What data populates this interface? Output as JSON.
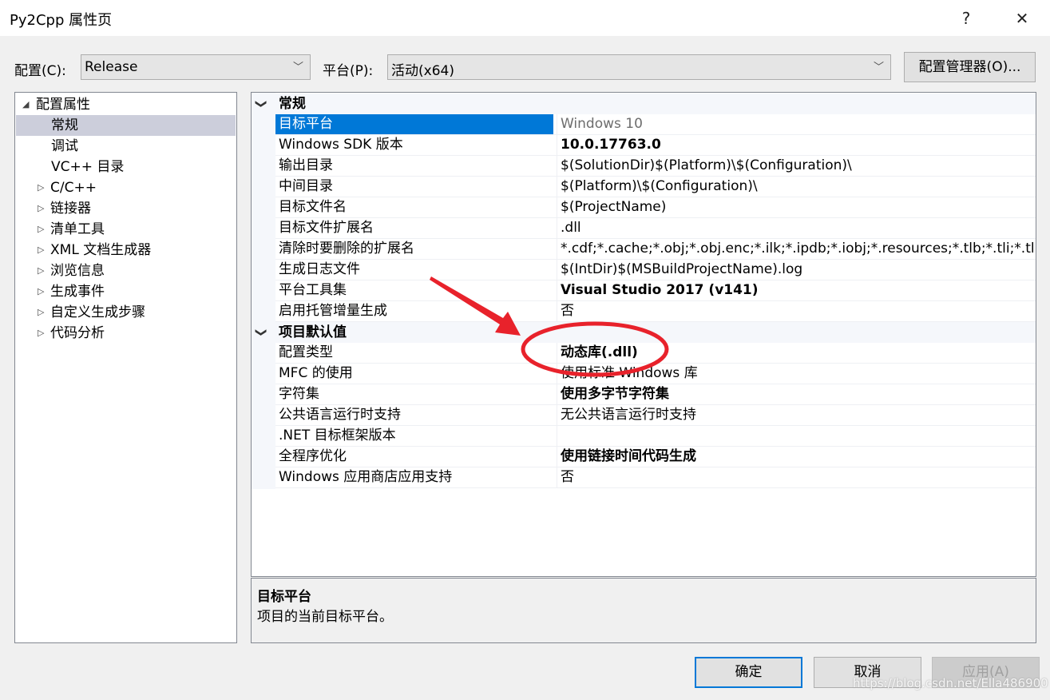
{
  "window": {
    "title": "Py2Cpp 属性页",
    "help": "?",
    "close": "✕"
  },
  "toolbar": {
    "config_label": "配置(C):",
    "config_value": "Release",
    "platform_label": "平台(P):",
    "platform_value": "活动(x64)",
    "config_manager": "配置管理器(O)..."
  },
  "tree": [
    {
      "label": "配置属性",
      "arrow": "◢",
      "expanded": true
    },
    {
      "label": "常规",
      "selected": true
    },
    {
      "label": "调试"
    },
    {
      "label": "VC++ 目录"
    },
    {
      "label": "C/C++",
      "arrow": "▷"
    },
    {
      "label": "链接器",
      "arrow": "▷"
    },
    {
      "label": "清单工具",
      "arrow": "▷"
    },
    {
      "label": "XML 文档生成器",
      "arrow": "▷"
    },
    {
      "label": "浏览信息",
      "arrow": "▷"
    },
    {
      "label": "生成事件",
      "arrow": "▷"
    },
    {
      "label": "自定义生成步骤",
      "arrow": "▷"
    },
    {
      "label": "代码分析",
      "arrow": "▷"
    }
  ],
  "grid": {
    "sections": [
      {
        "title": "常规",
        "rows": [
          {
            "name": "目标平台",
            "value": "Windows 10",
            "style": "g",
            "selected": true
          },
          {
            "name": "Windows SDK 版本",
            "value": "10.0.17763.0",
            "style": "b"
          },
          {
            "name": "输出目录",
            "value": "$(SolutionDir)$(Platform)\\$(Configuration)\\"
          },
          {
            "name": "中间目录",
            "value": "$(Platform)\\$(Configuration)\\"
          },
          {
            "name": "目标文件名",
            "value": "$(ProjectName)"
          },
          {
            "name": "目标文件扩展名",
            "value": ".dll"
          },
          {
            "name": "清除时要删除的扩展名",
            "value": "*.cdf;*.cache;*.obj;*.obj.enc;*.ilk;*.ipdb;*.iobj;*.resources;*.tlb;*.tli;*.tlh;*.tmp;*.rsp;"
          },
          {
            "name": "生成日志文件",
            "value": "$(IntDir)$(MSBuildProjectName).log"
          },
          {
            "name": "平台工具集",
            "value": "Visual Studio 2017 (v141)",
            "style": "b"
          },
          {
            "name": "启用托管增量生成",
            "value": "否"
          }
        ]
      },
      {
        "title": "项目默认值",
        "rows": [
          {
            "name": "配置类型",
            "value": "动态库(.dll)",
            "style": "b"
          },
          {
            "name": "MFC 的使用",
            "value": "使用标准 Windows 库"
          },
          {
            "name": "字符集",
            "value": "使用多字节字符集",
            "style": "b"
          },
          {
            "name": "公共语言运行时支持",
            "value": "无公共语言运行时支持"
          },
          {
            "name": ".NET 目标框架版本",
            "value": ""
          },
          {
            "name": "全程序优化",
            "value": "使用链接时间代码生成",
            "style": "b"
          },
          {
            "name": "Windows 应用商店应用支持",
            "value": "否"
          }
        ]
      }
    ]
  },
  "description": {
    "title": "目标平台",
    "text": "项目的当前目标平台。"
  },
  "buttons": {
    "ok": "确定",
    "cancel": "取消",
    "apply": "应用(A)"
  },
  "watermark": "https://blog.csdn.net/Ella486900",
  "colors": {
    "selection": "#0078d7",
    "annotation": "#e8222b"
  }
}
